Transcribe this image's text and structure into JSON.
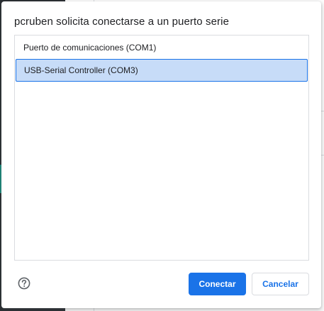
{
  "dialog": {
    "title": "pcruben solicita conectarse a un puerto serie",
    "devices": [
      {
        "label": "Puerto de comunicaciones (COM1)",
        "selected": false
      },
      {
        "label": "USB-Serial Controller (COM3)",
        "selected": true
      }
    ],
    "help_icon": "help-circle-icon",
    "connect_label": "Conectar",
    "cancel_label": "Cancelar"
  },
  "colors": {
    "accent": "#1a73e8",
    "selected_bg": "#c7dcf8",
    "title_text": "#202124",
    "border": "#dadce0"
  }
}
